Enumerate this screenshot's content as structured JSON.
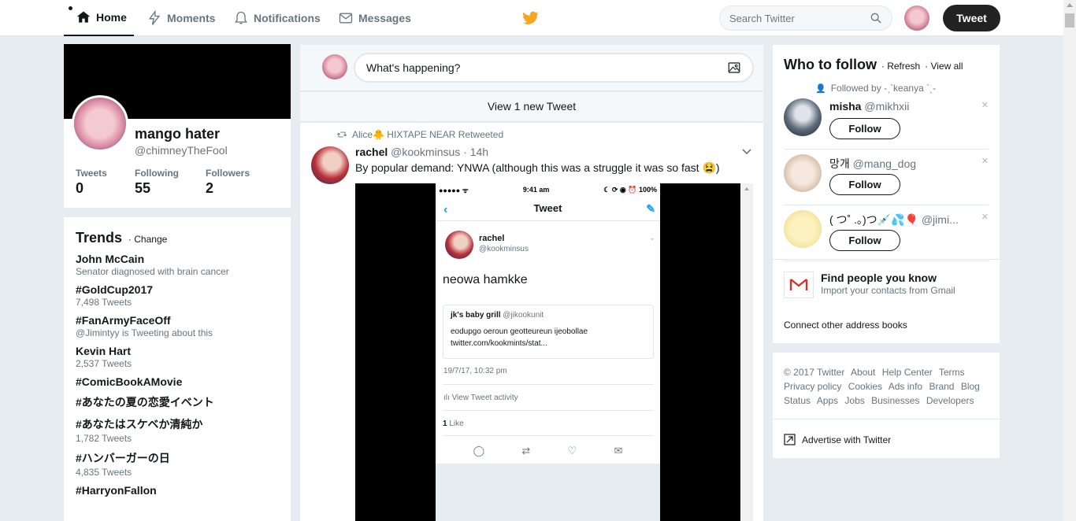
{
  "nav": {
    "home": "Home",
    "moments": "Moments",
    "notifications": "Notifications",
    "messages": "Messages",
    "search_placeholder": "Search Twitter",
    "tweet_button": "Tweet"
  },
  "profile": {
    "name": "mango hater",
    "handle": "@chimneyTheFool",
    "stats": [
      {
        "label": "Tweets",
        "value": "0"
      },
      {
        "label": "Following",
        "value": "55"
      },
      {
        "label": "Followers",
        "value": "2"
      }
    ]
  },
  "trends": {
    "title": "Trends",
    "change": "Change",
    "items": [
      {
        "name": "John McCain",
        "sub": "Senator diagnosed with brain cancer"
      },
      {
        "name": "#GoldCup2017",
        "sub": "7,498 Tweets"
      },
      {
        "name": "#FanArmyFaceOff",
        "sub": "@Jimintyy is Tweeting about this"
      },
      {
        "name": "Kevin Hart",
        "sub": "2,537 Tweets"
      },
      {
        "name": "#ComicBookAMovie",
        "sub": ""
      },
      {
        "name": "#あなたの夏の恋愛イベント",
        "sub": ""
      },
      {
        "name": "#あなたはスケベか清純か",
        "sub": "1,782 Tweets"
      },
      {
        "name": "#ハンバーガーの日",
        "sub": "4,835 Tweets"
      },
      {
        "name": "#HarryonFallon",
        "sub": ""
      }
    ]
  },
  "compose": {
    "placeholder": "What's happening?"
  },
  "feed": {
    "new_tweets": "View 1 new Tweet",
    "tweet": {
      "retweeted_by": "Alice🐥 HIXTAPE NEAR Retweeted",
      "name": "rachel",
      "handle": "@kookminsus",
      "time": "· 14h",
      "text": "By popular demand: YNWA (although this was a struggle it was so fast 😫)"
    },
    "phone": {
      "carrier": "●●●●● ᯤ",
      "clock": "9:41 am",
      "battery": "☾ ⟳ ◉ ⏰ 100%",
      "title": "Tweet",
      "name": "rachel",
      "handle": "@kookminsus",
      "text": "neowa hamkke",
      "quote_name": "jk's baby grill",
      "quote_handle": "@jikookunit",
      "quote_text1": "eodupgo oeroun geotteureun ijeobollae",
      "quote_text2": "twitter.com/kookmints/stat...",
      "date": "19/7/17, 10:32 pm",
      "activity": "View Tweet activity",
      "likes_count": "1",
      "likes_label": "Like"
    }
  },
  "who_to_follow": {
    "title": "Who to follow",
    "refresh": "· Refresh",
    "view_all": "· View all",
    "followed_by": "Followed by -ˏˋkeanya ˊˎ-",
    "follow_label": "Follow",
    "suggestions": [
      {
        "name": "misha",
        "handle": "@mikhxii"
      },
      {
        "name": "망개",
        "handle": "@mang_dog"
      },
      {
        "name": "( つ˚ .｡)つ💉💦🎈",
        "handle": "@jimi..."
      }
    ],
    "find_title": "Find people you know",
    "find_sub": "Import your contacts from Gmail",
    "connect": "Connect other address books"
  },
  "footer": {
    "links": [
      "© 2017 Twitter",
      "About",
      "Help Center",
      "Terms",
      "Privacy policy",
      "Cookies",
      "Ads info",
      "Brand",
      "Blog",
      "Status",
      "Apps",
      "Jobs",
      "Businesses",
      "Developers"
    ],
    "advertise": "Advertise with Twitter"
  },
  "colors": {
    "brand_blue": "#1da1f2",
    "logo_orange": "#f5a623",
    "text_dark": "#14171a",
    "text_muted": "#66757f"
  }
}
